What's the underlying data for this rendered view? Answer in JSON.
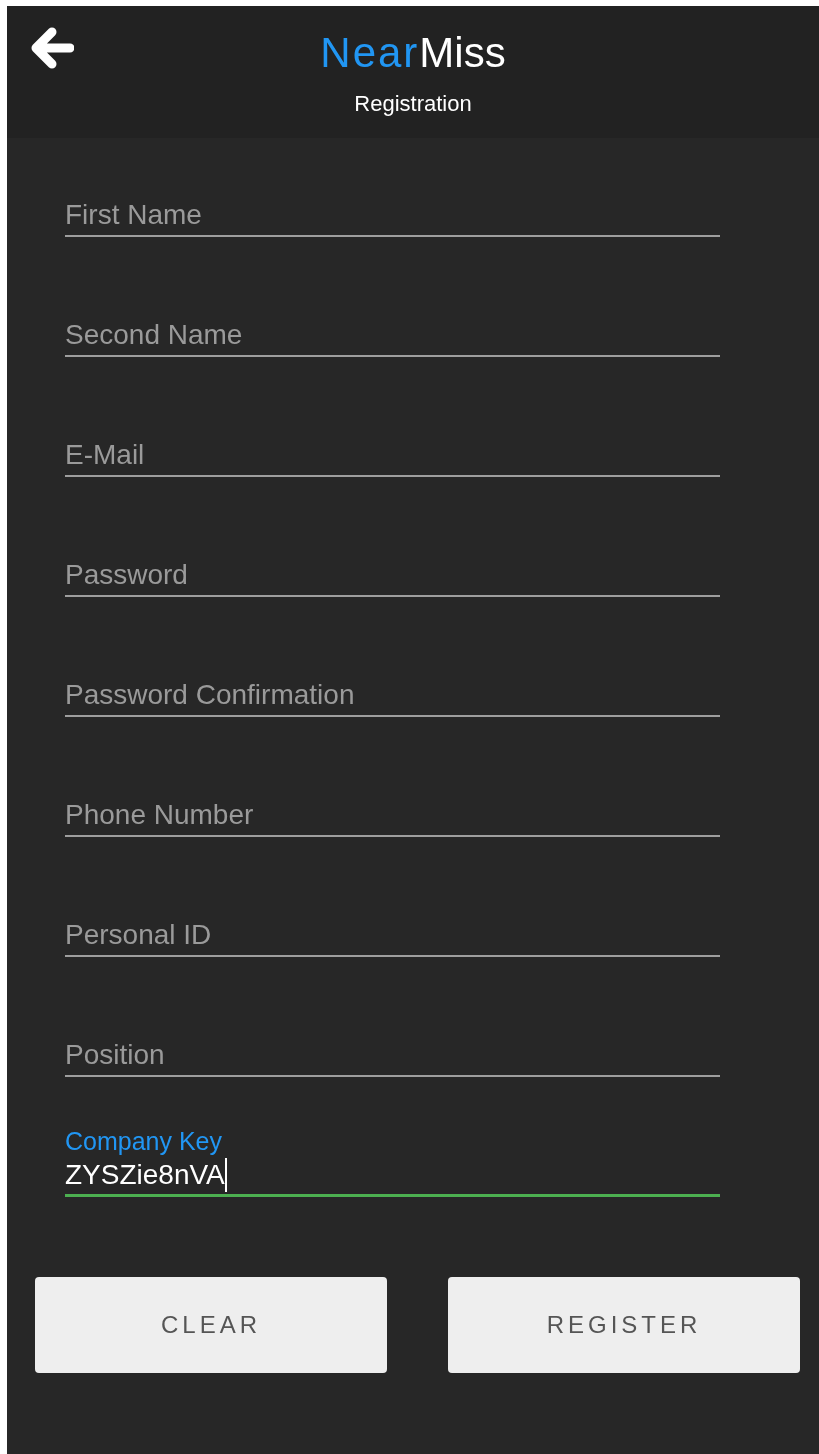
{
  "header": {
    "logo": {
      "first": "Near",
      "second": "Miss"
    },
    "subtitle": "Registration"
  },
  "fields": [
    {
      "kind": "placeholder",
      "placeholder": "First Name",
      "focused": false
    },
    {
      "kind": "placeholder",
      "placeholder": "Second Name",
      "focused": false
    },
    {
      "kind": "placeholder",
      "placeholder": "E-Mail",
      "focused": false
    },
    {
      "kind": "placeholder",
      "placeholder": "Password",
      "focused": false
    },
    {
      "kind": "placeholder",
      "placeholder": "Password Confirmation",
      "focused": false
    },
    {
      "kind": "placeholder",
      "placeholder": "Phone Number",
      "focused": false
    },
    {
      "kind": "placeholder",
      "placeholder": "Personal ID",
      "focused": false
    },
    {
      "kind": "placeholder",
      "placeholder": "Position",
      "focused": false
    },
    {
      "kind": "labeled",
      "label": "Company Key",
      "value": "ZYSZie8nVA",
      "focused": true
    }
  ],
  "buttons": [
    "CLEAR",
    "REGISTER"
  ]
}
